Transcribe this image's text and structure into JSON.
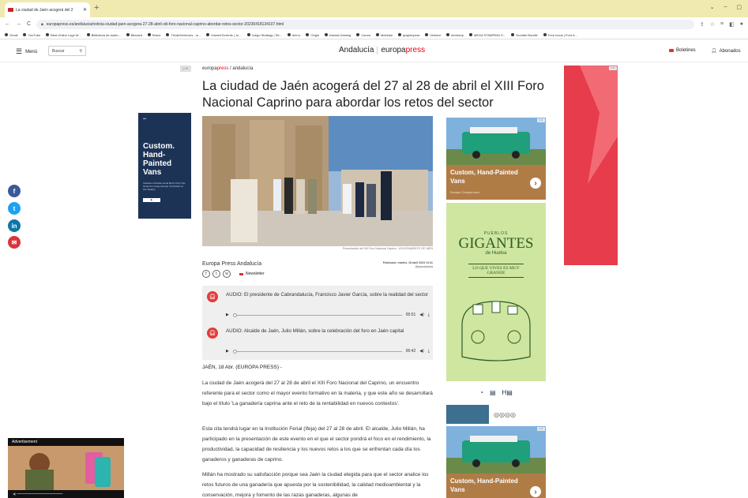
{
  "browser": {
    "tab_title": "La ciudad de Jaén acogerá del 2",
    "new_tab": "+",
    "url": "europapress.es/andalucia/noticia-ciudad-jaen-acogera-27-28-abril-xiii-foro-nacional-caprino-abordar-retos-sector-20230418134107.html",
    "bookmarks": [
      "Gmail",
      "YouTube",
      "Best Online Logo M...",
      "Biblioteca de audio...",
      "Blizzard",
      "Brave",
      "TrivalOnHeroes - iu...",
      "GamesTorrents | Ju...",
      "Juego Strategy | Str...",
      "itch.io",
      "Origin",
      "Instant-Gaming",
      "Canva",
      "Mobirise",
      "graphicpear",
      "Vertami",
      "Vecteezy",
      "MEGA STAMPING K...",
      "Humble Bundle",
      "Free Icons | Font A..."
    ]
  },
  "header": {
    "menu_label": "Menú",
    "search_label": "Buscar",
    "logo_region": "Andalucía",
    "logo_brand_a": "europa",
    "logo_brand_b": "press",
    "boletines": "Boletines",
    "abonados": "Abonados"
  },
  "article": {
    "breadcrumb_brand_a": "europa",
    "breadcrumb_brand_b": "press",
    "breadcrumb_section": "andalucía",
    "title": "La ciudad de Jaén acogerá del 27 al 28 de abril el XIII Foro Nacional Caprino para abordar los retos del sector",
    "caption": "Presentación del XIII Foro Nacional Caprino - AYUNTAMIENTO DE JAÉN",
    "author": "Europa Press Andalucía",
    "pubdate": "Publicado: martes, 18 abril 2023 13:41",
    "pubhandle": "@epandalucia",
    "newsletter": "Newsletter",
    "audios": [
      {
        "title": "AUDIO: El presidente de Cabrandalucía, Francisco Javier García, sobre la realidad del sector",
        "time": "00:51"
      },
      {
        "title": "AUDIO: Alcalde de Jaén, Julio Millán, sobre la celebración del foro en Jaén capital",
        "time": "00:42"
      }
    ],
    "dateline": "JAÉN, 18 Abr. (EUROPA PRESS) -",
    "paragraphs": [
      "La ciudad de Jaén acogerá del 27 al 28 de abril el XIII Foro Nacional del Caprino, un encuentro referente para el sector como el mayor evento formativo en la materia, y que este año se desarrollará bajo el título 'La ganadería caprina ante el reto de la rentabilidad en nuevos contextos'.",
      "Esta cita tendrá lugar en la Institución Ferial (Ifeja) del 27 al 28 de abril. El alcalde, Julio Millán, ha participado en la presentación de este evento en el que el sector pondrá el foco en el rendimiento, la productividad, la capacidad de resiliencia y los nuevos retos a los que se enfrentan cada día los ganaderos y ganaderas de caprino.",
      "Millán ha mostrado su satisfacción porque sea Jaén la ciudad elegida para que el sector analice los retos futuros de una ganadería que apuesta por la sostenibilidad, la calidad medioambiental y la conservación, mejora y fomento de las razas ganaderas, algunas de"
    ]
  },
  "ads": {
    "left_van_title": "Custom. Hand- Painted Vans",
    "left_van_body": "Includes a Double Good Bed in Pop Top. Great For Large Groups. Find More at Our Nearby",
    "van_title": "Custom, Hand-Painted Vans",
    "van_sub": "Escape Campervans",
    "pueblos_1": "PUEBLOS",
    "pueblos_2": "GIGANTES",
    "pueblos_3": "de Huelva",
    "pueblos_4": "LO QUE VIVES ES MUY GRANDE",
    "advertisement": "Advertisement"
  },
  "colors": {
    "brand_red": "#e2001a",
    "audio_icon": "#e23b3b",
    "tab_strip": "#f0e9b0"
  }
}
